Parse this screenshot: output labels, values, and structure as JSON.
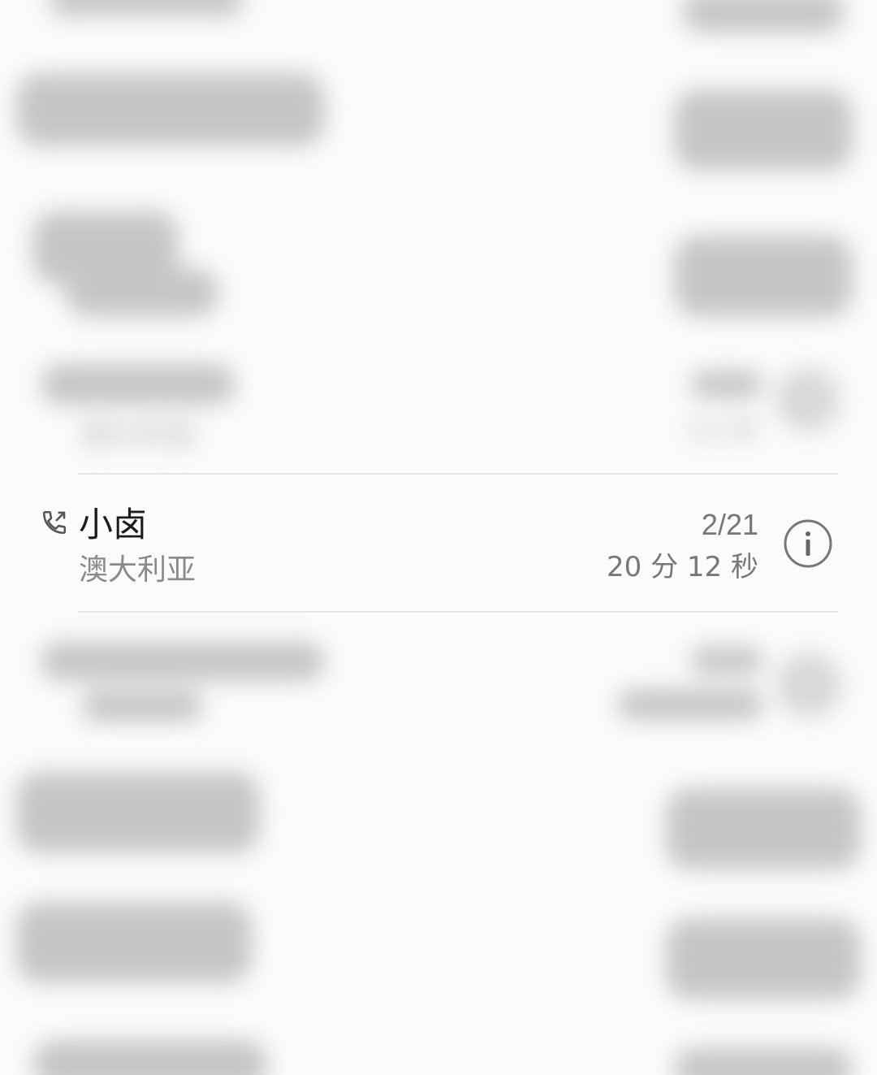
{
  "focused_call": {
    "name": "小卤",
    "location": "澳大利亚",
    "date": "2/21",
    "duration": "20 分 12 秒",
    "call_type_icon": "outgoing-call-icon",
    "info_icon": "info-icon"
  },
  "blurred_calls": [
    {
      "name": "",
      "location": "澳大利亚",
      "date": "",
      "duration": "15 秒"
    },
    {
      "name": "",
      "location": "",
      "date": "",
      "duration": ""
    }
  ],
  "colors": {
    "primary_text": "#1c1c1c",
    "secondary_text": "#8a8a8a",
    "meta_text": "#777777",
    "divider": "#e6e6e6",
    "background": "#fbfbfb"
  }
}
